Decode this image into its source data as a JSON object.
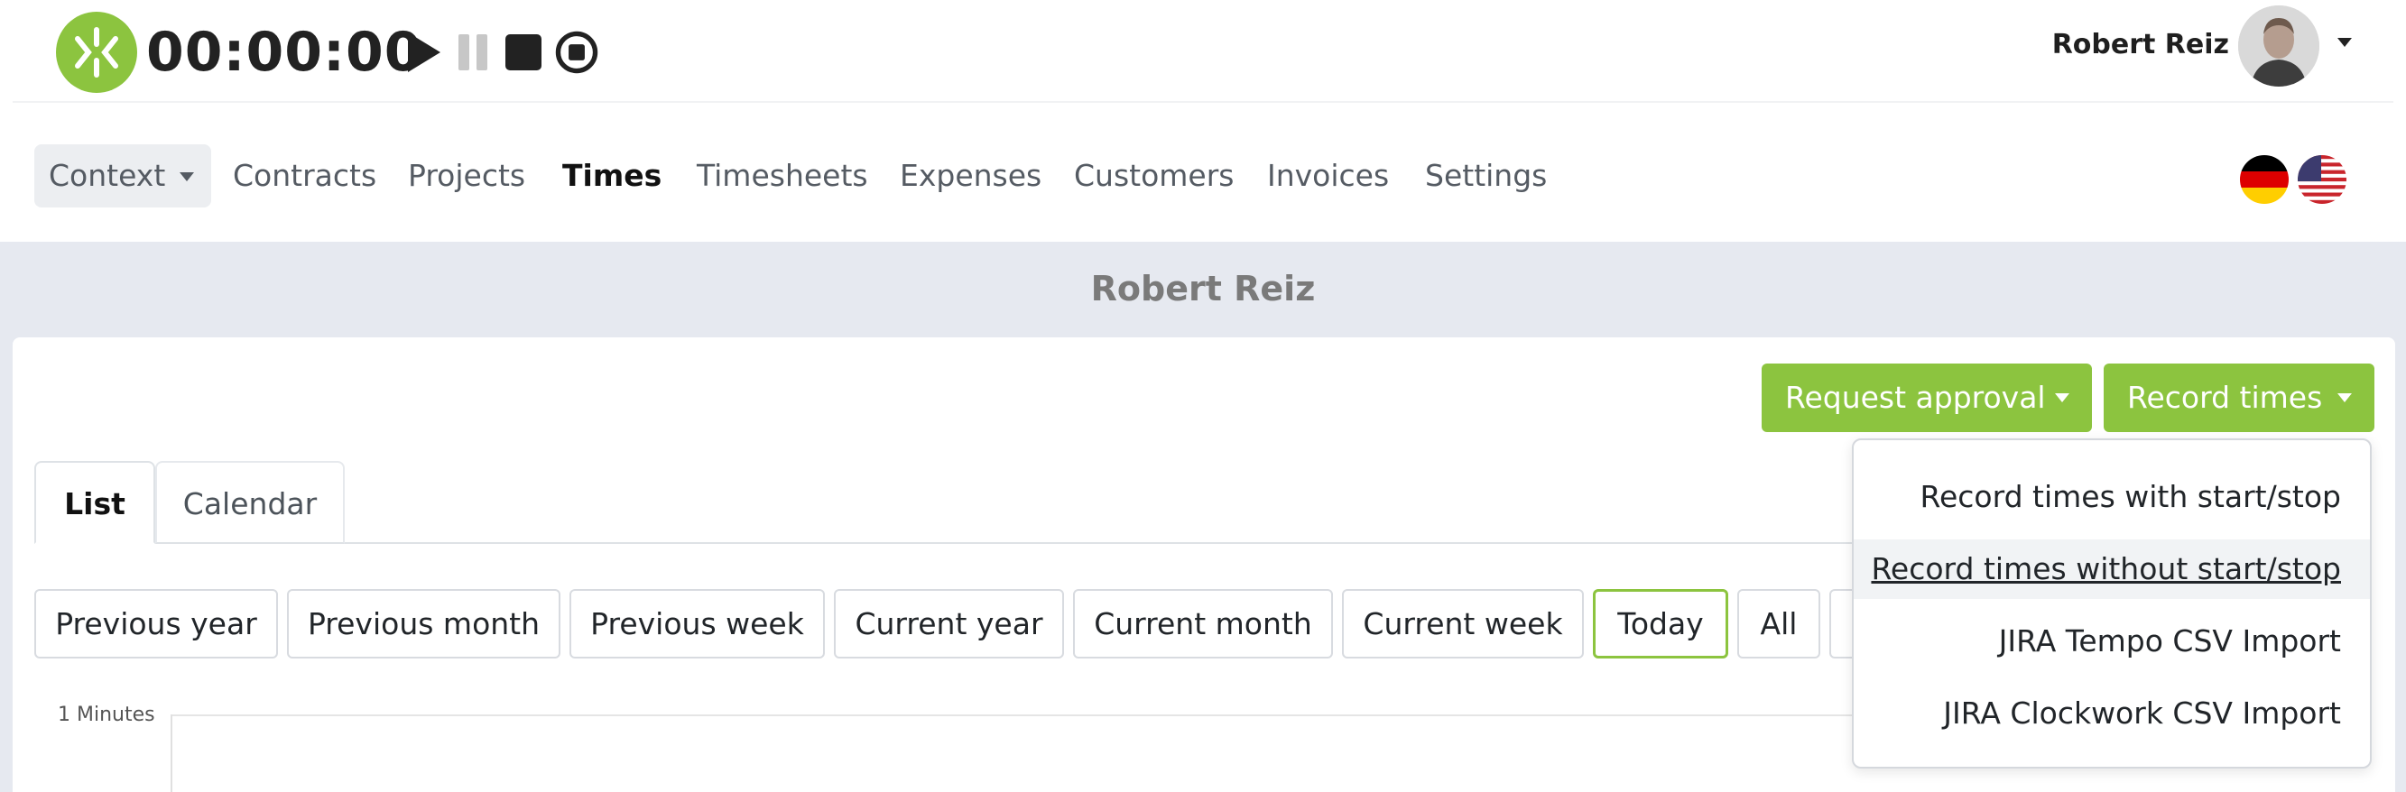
{
  "timer": {
    "display": "00:00:00",
    "icons": {
      "logo": "app-logo",
      "play": "play-icon",
      "pause": "pause-icon",
      "stop": "stop-icon",
      "record": "stop-recording-icon"
    }
  },
  "user": {
    "name": "Robert Reiz",
    "avatar": "user-avatar",
    "menu_icon": "caret-down-icon"
  },
  "nav": {
    "context": "Context",
    "items": [
      "Contracts",
      "Projects",
      "Times",
      "Timesheets",
      "Expenses",
      "Customers",
      "Invoices",
      "Settings"
    ],
    "active": "Times",
    "languages": [
      "german-flag-icon",
      "us-flag-icon"
    ]
  },
  "page": {
    "heading": "Robert Reiz"
  },
  "actions": {
    "request_approval": "Request approval",
    "record_times": "Record times"
  },
  "tabs": [
    "List",
    "Calendar"
  ],
  "active_tab": "List",
  "filters": [
    "Previous year",
    "Previous month",
    "Previous week",
    "Current year",
    "Current month",
    "Current week",
    "Today",
    "All"
  ],
  "active_filter": "Today",
  "chart": {
    "y_label": "1 Minutes"
  },
  "dropdown": {
    "items": [
      "Record times with start/stop",
      "Record times without start/stop",
      "JIRA Tempo CSV Import",
      "JIRA Clockwork CSV Import"
    ],
    "hovered": "Record times without start/stop"
  },
  "colors": {
    "brand_green": "#8cc43f",
    "page_background": "#e6e9f0",
    "active_text": "#111111"
  }
}
